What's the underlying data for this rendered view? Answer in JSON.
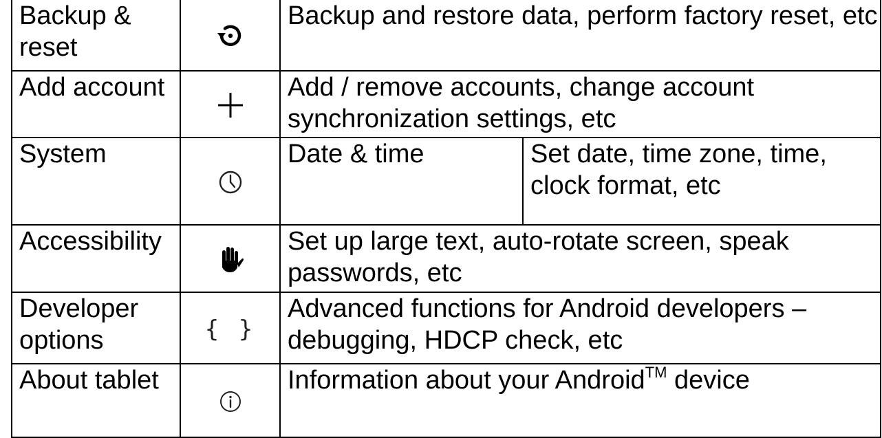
{
  "rows": [
    {
      "name": "Backup &\nreset",
      "icon": "backup-restore-icon",
      "description": "Backup and restore data, perform factory reset, etc"
    },
    {
      "name": "Add account",
      "icon": "plus-icon",
      "description": "Add / remove accounts, change account synchronization settings, etc"
    },
    {
      "name": "System",
      "icon": "clock-icon",
      "sub_item": "Date & time",
      "description": "Set date, time zone, time, clock format, etc"
    },
    {
      "name": "Accessibility",
      "icon": "hand-icon",
      "description": "Set up large text, auto-rotate screen, speak passwords, etc"
    },
    {
      "name": "Developer options",
      "icon": "braces-icon",
      "icon_text": "{ }",
      "description": "Advanced functions for Android developers – debugging, HDCP check, etc"
    },
    {
      "name": "About tablet",
      "icon": "info-icon",
      "description_prefix": "Information about your Android",
      "description_sup": "TM",
      "description_suffix": " device"
    }
  ]
}
